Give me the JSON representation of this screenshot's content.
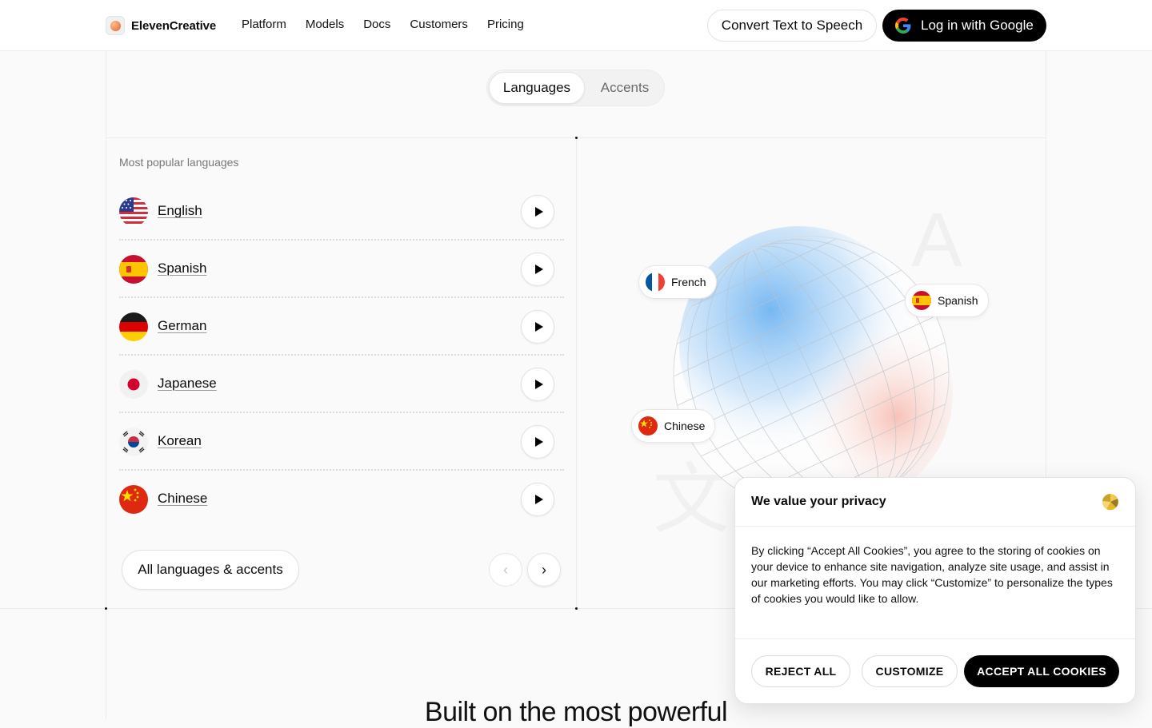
{
  "header": {
    "brand": "ElevenCreative",
    "nav": [
      "Platform",
      "Models",
      "Docs",
      "Customers",
      "Pricing"
    ],
    "convert_label": "Convert Text to Speech",
    "login_label": "Log in with Google"
  },
  "tabs": [
    {
      "label": "Languages",
      "active": true
    },
    {
      "label": "Accents",
      "active": false
    }
  ],
  "list": {
    "title": "Most popular languages",
    "items": [
      {
        "label": "English",
        "flag": "us-flag"
      },
      {
        "label": "Spanish",
        "flag": "spain-flag"
      },
      {
        "label": "German",
        "flag": "germany-flag"
      },
      {
        "label": "Japanese",
        "flag": "japan-flag"
      },
      {
        "label": "Korean",
        "flag": "korea-flag"
      },
      {
        "label": "Chinese",
        "flag": "china-flag"
      }
    ],
    "all_label": "All languages & accents"
  },
  "globe_chips": {
    "french": "French",
    "spanish": "Spanish",
    "chinese": "Chinese"
  },
  "bottom_heading": "Built on the most powerful",
  "cookie": {
    "title": "We value your privacy",
    "body": "By clicking “Accept All Cookies”, you agree to the storing of cookies on your device to enhance site navigation, analyze site usage, and assist in our marketing efforts. You may click “Customize” to personalize the types of cookies you would like to allow.",
    "reject_label": "REJECT ALL",
    "customize_label": "CUSTOMIZE",
    "accept_label": "ACCEPT ALL COOKIES"
  },
  "colors": {
    "accent": "#000000",
    "page_bg": "#fafafa"
  }
}
